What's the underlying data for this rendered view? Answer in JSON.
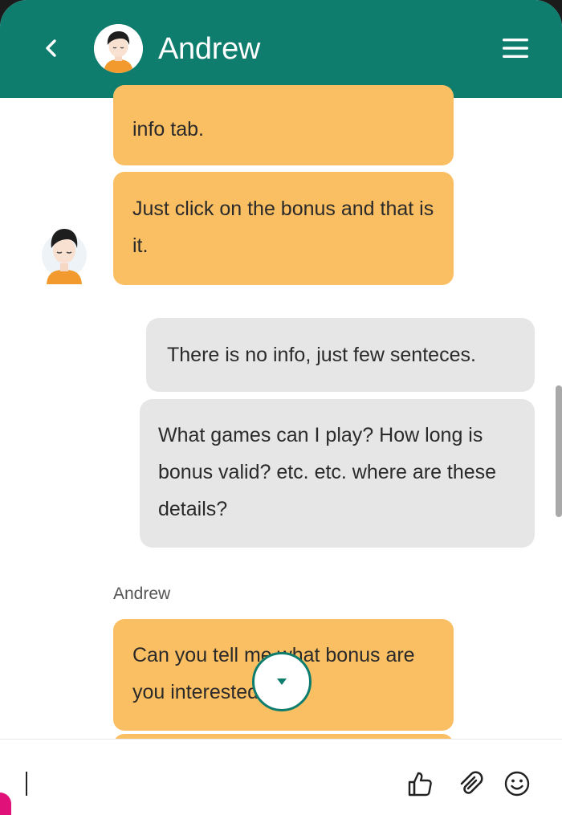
{
  "header": {
    "title": "Andrew",
    "back_icon": "chevron-left-icon",
    "menu_icon": "hamburger-menu-icon",
    "color": "#0f7d6d"
  },
  "messages": [
    {
      "from": "agent",
      "text": "info tab."
    },
    {
      "from": "agent",
      "text": "Just click on the bonus and that is it."
    },
    {
      "from": "user",
      "text": "There is no info, just few senteces."
    },
    {
      "from": "user",
      "text": "What games can I play? How long is bonus valid? etc. etc. where are these details?"
    },
    {
      "from": "agent",
      "sender": "Andrew",
      "text": "Can you tell me what bonus are you interested in?"
    }
  ],
  "colors": {
    "agent_bubble": "#fbbf63",
    "user_bubble": "#e6e6e6",
    "accent": "#0f7d6d"
  },
  "composer": {
    "value": "",
    "placeholder": ""
  },
  "toolbar": {
    "like_icon": "thumbs-up-icon",
    "attach_icon": "paperclip-icon",
    "emoji_icon": "emoji-icon",
    "scroll_icon": "caret-down-icon"
  }
}
